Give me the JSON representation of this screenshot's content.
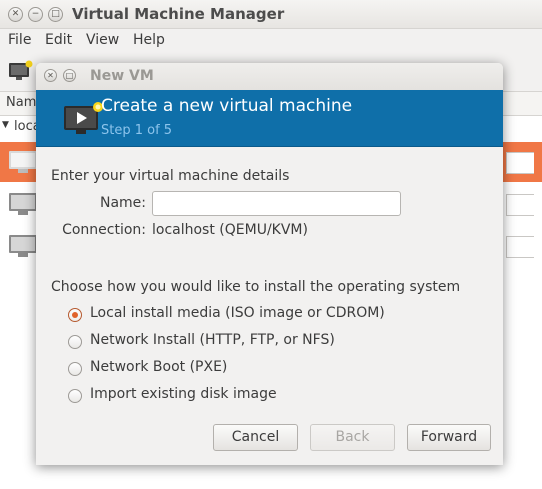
{
  "main_window": {
    "title": "Virtual Machine Manager",
    "menu": [
      "File",
      "Edit",
      "View",
      "Help"
    ],
    "list_header": "Name",
    "connection_label": "local"
  },
  "dialog": {
    "title": "New VM",
    "banner_title": "Create a new virtual machine",
    "banner_step": "Step 1 of 5",
    "details_heading": "Enter your virtual machine details",
    "name_label": "Name:",
    "name_value": "",
    "connection_label": "Connection:",
    "connection_value": "localhost (QEMU/KVM)",
    "install_heading": "Choose how you would like to install the operating system",
    "install_options": [
      {
        "label": "Local install media (ISO image or CDROM)",
        "checked": true
      },
      {
        "label": "Network Install (HTTP, FTP, or NFS)",
        "checked": false
      },
      {
        "label": "Network Boot (PXE)",
        "checked": false
      },
      {
        "label": "Import existing disk image",
        "checked": false
      }
    ],
    "buttons": {
      "cancel": "Cancel",
      "back": "Back",
      "forward": "Forward"
    }
  },
  "colors": {
    "banner": "#0f6fa9",
    "selected_row": "#f07746",
    "radio_accent": "#e0622a"
  }
}
